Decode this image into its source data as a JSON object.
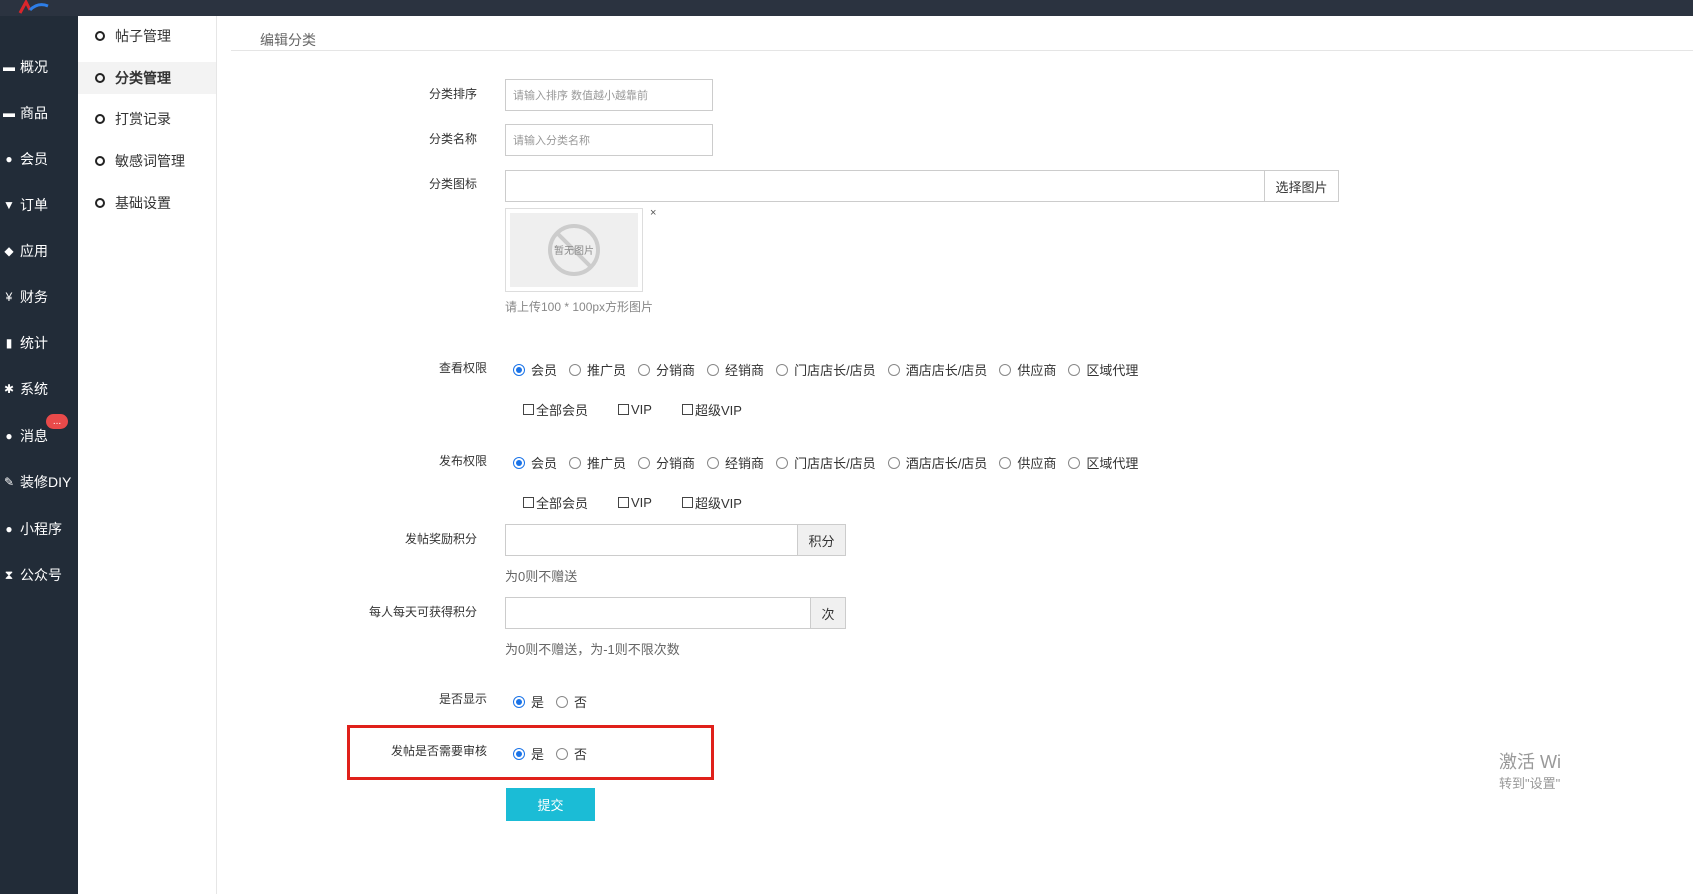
{
  "left_nav": [
    {
      "icon": "card-icon",
      "glyph": "▬",
      "label": "概况"
    },
    {
      "icon": "card-icon",
      "glyph": "▬",
      "label": "商品"
    },
    {
      "icon": "users-icon",
      "glyph": "●",
      "label": "会员"
    },
    {
      "icon": "cart-icon",
      "glyph": "▼",
      "label": "订单"
    },
    {
      "icon": "cubes-icon",
      "glyph": "◆",
      "label": "应用"
    },
    {
      "icon": "yen-icon",
      "glyph": "¥",
      "label": "财务"
    },
    {
      "icon": "bar-chart-icon",
      "glyph": "▮",
      "label": "统计"
    },
    {
      "icon": "gears-icon",
      "glyph": "✱",
      "label": "系统"
    },
    {
      "icon": "comment-icon",
      "glyph": "●",
      "label": "消息"
    },
    {
      "icon": "gavel-icon",
      "glyph": "✎",
      "label": "装修DIY"
    },
    {
      "icon": "wechat-icon",
      "glyph": "●",
      "label": "小程序"
    },
    {
      "icon": "hourglass-icon",
      "glyph": "⧗",
      "label": "公众号"
    }
  ],
  "message_badge": "...",
  "sub_nav": [
    "帖子管理",
    "分类管理",
    "打赏记录",
    "敏感词管理",
    "基础设置"
  ],
  "breadcrumb": "编辑分类",
  "form": {
    "sort_label": "分类排序",
    "sort_placeholder": "请输入排序 数值越小越靠前",
    "name_label": "分类名称",
    "name_placeholder": "请输入分类名称",
    "icon_label": "分类图标",
    "choose_image": "选择图片",
    "no_image": "暂无图片",
    "remove": "×",
    "image_hint": "请上传100 * 100px方形图片",
    "view_perm_label": "查看权限",
    "post_perm_label": "发布权限",
    "roles": [
      "会员",
      "推广员",
      "分销商",
      "经销商",
      "门店店长/店员",
      "酒店店长/店员",
      "供应商",
      "区域代理"
    ],
    "member_levels": [
      "全部会员",
      "VIP",
      "超级VIP"
    ],
    "reward_label": "发帖奖励积分",
    "reward_unit": "积分",
    "reward_hint": "为0则不赠送",
    "daily_label": "每人每天可获得积分",
    "daily_unit": "次",
    "daily_hint": "为0则不赠送，为-1则不限次数",
    "show_label": "是否显示",
    "audit_label": "发帖是否需要审核",
    "yes": "是",
    "no": "否",
    "submit": "提交"
  },
  "watermark": {
    "line1": "激活 Wi",
    "line2": "转到\"设置\""
  }
}
